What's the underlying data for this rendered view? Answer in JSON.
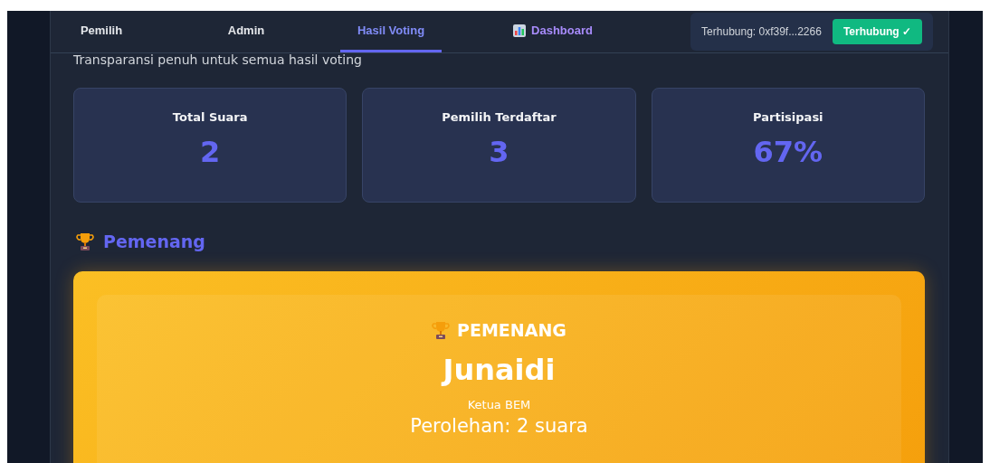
{
  "tabs": [
    {
      "label": "Pemilih",
      "selected": false,
      "kind": "text"
    },
    {
      "label": "Admin",
      "selected": false,
      "kind": "text"
    },
    {
      "label": "Hasil Voting",
      "selected": true,
      "kind": "text"
    },
    {
      "label": "Dashboard",
      "selected": false,
      "kind": "chart"
    }
  ],
  "connection": {
    "label": "Terhubung: 0xf39f...2266",
    "button": "Terhubung ✓"
  },
  "subtitle": "Transparansi penuh untuk semua hasil voting",
  "stats": [
    {
      "label": "Total Suara",
      "value": "2"
    },
    {
      "label": "Pemilih Terdaftar",
      "value": "3"
    },
    {
      "label": "Partisipasi",
      "value": "67%"
    }
  ],
  "winner_section": {
    "heading": "Pemenang",
    "badge": "PEMENANG",
    "name": "Junaidi",
    "position": "Ketua BEM",
    "votes": "Perolehan: 2 suara"
  }
}
